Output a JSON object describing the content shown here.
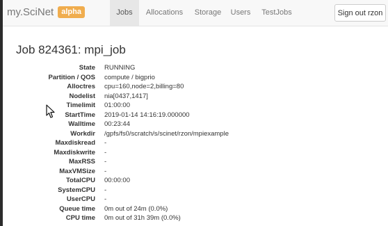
{
  "brand": {
    "name": "my.SciNet",
    "badge": "alpha"
  },
  "nav": [
    {
      "label": "Jobs",
      "active": true
    },
    {
      "label": "Allocations",
      "active": false
    },
    {
      "label": "Storage",
      "active": false
    },
    {
      "label": "Users",
      "active": false
    },
    {
      "label": "TestJobs",
      "active": false
    }
  ],
  "signout_label": "Sign out rzon",
  "job": {
    "title": "Job 824361: mpi_job",
    "fields": [
      {
        "label": "State",
        "value": "RUNNING"
      },
      {
        "label": "Partition / QOS",
        "value": "compute / bigprio"
      },
      {
        "label": "Alloctres",
        "value": "cpu=160,node=2,billing=80"
      },
      {
        "label": "Nodelist",
        "value": "nia[0437,1417]"
      },
      {
        "label": "Timelimit",
        "value": "01:00:00"
      },
      {
        "label": "StartTime",
        "value": "2019-01-14 14:16:19.000000"
      },
      {
        "label": "Walltime",
        "value": "00:23:44"
      },
      {
        "label": "Workdir",
        "value": "/gpfs/fs0/scratch/s/scinet/rzon/mpiexample"
      },
      {
        "label": "Maxdiskread",
        "value": "-"
      },
      {
        "label": "Maxdiskwrite",
        "value": "-"
      },
      {
        "label": "MaxRSS",
        "value": "-"
      },
      {
        "label": "MaxVMSize",
        "value": "-"
      },
      {
        "label": "TotalCPU",
        "value": "00:00:00"
      },
      {
        "label": "SystemCPU",
        "value": "-"
      },
      {
        "label": "UserCPU",
        "value": "-"
      },
      {
        "label": "Queue time",
        "value": "0m out of 24m (0.0%)"
      },
      {
        "label": "CPU time",
        "value": "0m out of 31h 39m (0.0%)"
      }
    ]
  },
  "colors": {
    "badge": "#f0ad4e",
    "navbar_bg": "#f8f8f8",
    "active_tab_bg": "#e7e7e7"
  },
  "icons": {
    "cursor": "mouse-pointer-icon"
  }
}
